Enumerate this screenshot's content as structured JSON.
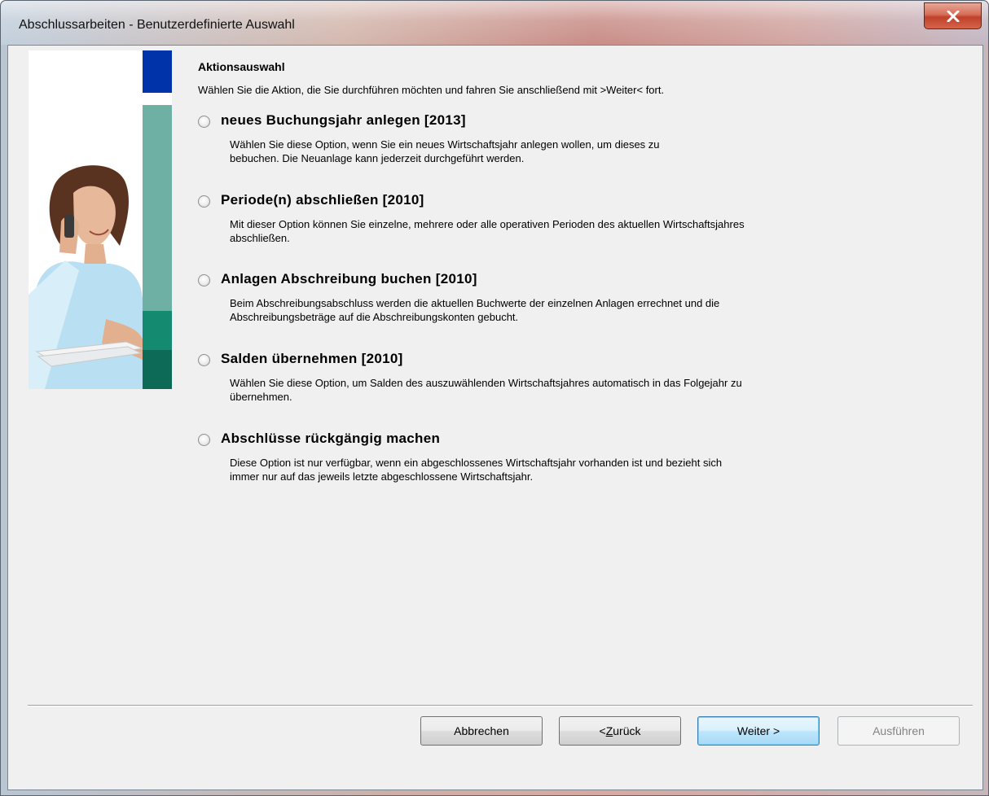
{
  "window": {
    "title": "Abschlussarbeiten - Benutzerdefinierte Auswahl"
  },
  "main": {
    "heading": "Aktionsauswahl",
    "subheading": "Wählen Sie die Aktion, die Sie durchführen möchten und fahren Sie anschließend mit >Weiter< fort.",
    "options": [
      {
        "label": "neues Buchungsjahr anlegen [2013]",
        "desc_line1": "Wählen Sie diese Option, wenn Sie ein neues Wirtschaftsjahr anlegen wollen, um dieses zu",
        "desc_line2": "bebuchen. Die Neuanlage kann jederzeit durchgeführt werden.",
        "selected": false
      },
      {
        "label": "Periode(n) abschließen [2010]",
        "desc_line1": "Mit dieser Option können Sie einzelne, mehrere oder alle operativen Perioden des aktuellen Wirtschaftsjahres",
        "desc_line2": "abschließen.",
        "selected": false
      },
      {
        "label": "Anlagen Abschreibung buchen [2010]",
        "desc_line1": "Beim Abschreibungsabschluss werden die aktuellen Buchwerte der einzelnen Anlagen errechnet und die",
        "desc_line2": "Abschreibungsbeträge auf die Abschreibungskonten gebucht.",
        "selected": false
      },
      {
        "label": "Salden übernehmen [2010]",
        "desc_line1": "Wählen Sie diese Option, um Salden des auszuwählenden Wirtschaftsjahres automatisch in das Folgejahr zu",
        "desc_line2": "übernehmen.",
        "selected": false
      },
      {
        "label": "Abschlüsse rückgängig machen",
        "desc_line1": "Diese Option ist nur verfügbar, wenn ein abgeschlossenes Wirtschaftsjahr vorhanden ist und bezieht sich",
        "desc_line2": "immer nur auf das jeweils letzte abgeschlossene Wirtschaftsjahr.",
        "selected": false
      }
    ]
  },
  "buttons": {
    "cancel": "Abbrechen",
    "back_prefix": "< ",
    "back_accel": "Z",
    "back_rest": "urück",
    "next": "Weiter >",
    "execute": "Ausführen"
  },
  "colors": {
    "accent_blue": "#0033aa",
    "teal_light": "#6fb0a4",
    "teal_mid": "#148a70",
    "teal_dark": "#0d6a56"
  },
  "icons": {
    "close": "close-icon",
    "radio": "radio-button"
  }
}
